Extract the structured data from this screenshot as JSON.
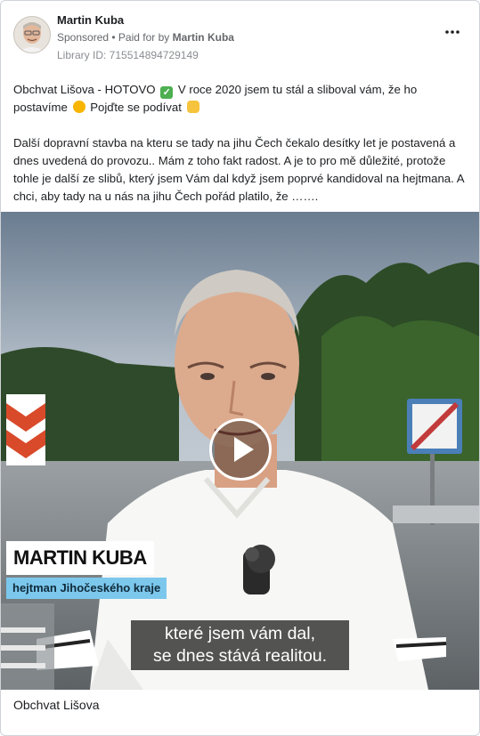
{
  "post": {
    "author": "Martin Kuba",
    "sponsored": "Sponsored",
    "paid_for_by": "Paid for by",
    "paid_for_name": "Martin Kuba",
    "library_id": "Library ID: 715514894729149",
    "more_icon": "more-horizontal-icon",
    "text_line1_a": "Obchvat Lišova - HOTOVO",
    "text_line1_b": "V roce 2020 jsem tu stál a sliboval vám, že ho postavíme",
    "text_line1_c": "Pojďte se podívat",
    "text_para2": "Další dopravní stavba na kteru se tady na jihu Čech čekalo desítky let je postavená a dnes uvedená do provozu.. Mám z toho fakt radost. A je to pro mě důležité, protože tohle je další ze slibů, který jsem Vám dal když jsem poprvé kandidoval na hejtmana. A chci, aby tady na u nás na jihu Čech pořád platilo, že …….",
    "emojis": [
      "check-mark-emoji",
      "grinning-face-emoji",
      "pointing-down-emoji"
    ]
  },
  "video": {
    "name_tag": "MARTIN KUBA",
    "role_tag": "hejtman Jihočeského kraje",
    "subtitle_line1": "které jsem vám dal,",
    "subtitle_line2": "se dnes stává realitou.",
    "play_icon": "play-icon"
  },
  "caption": "Obchvat Lišova"
}
